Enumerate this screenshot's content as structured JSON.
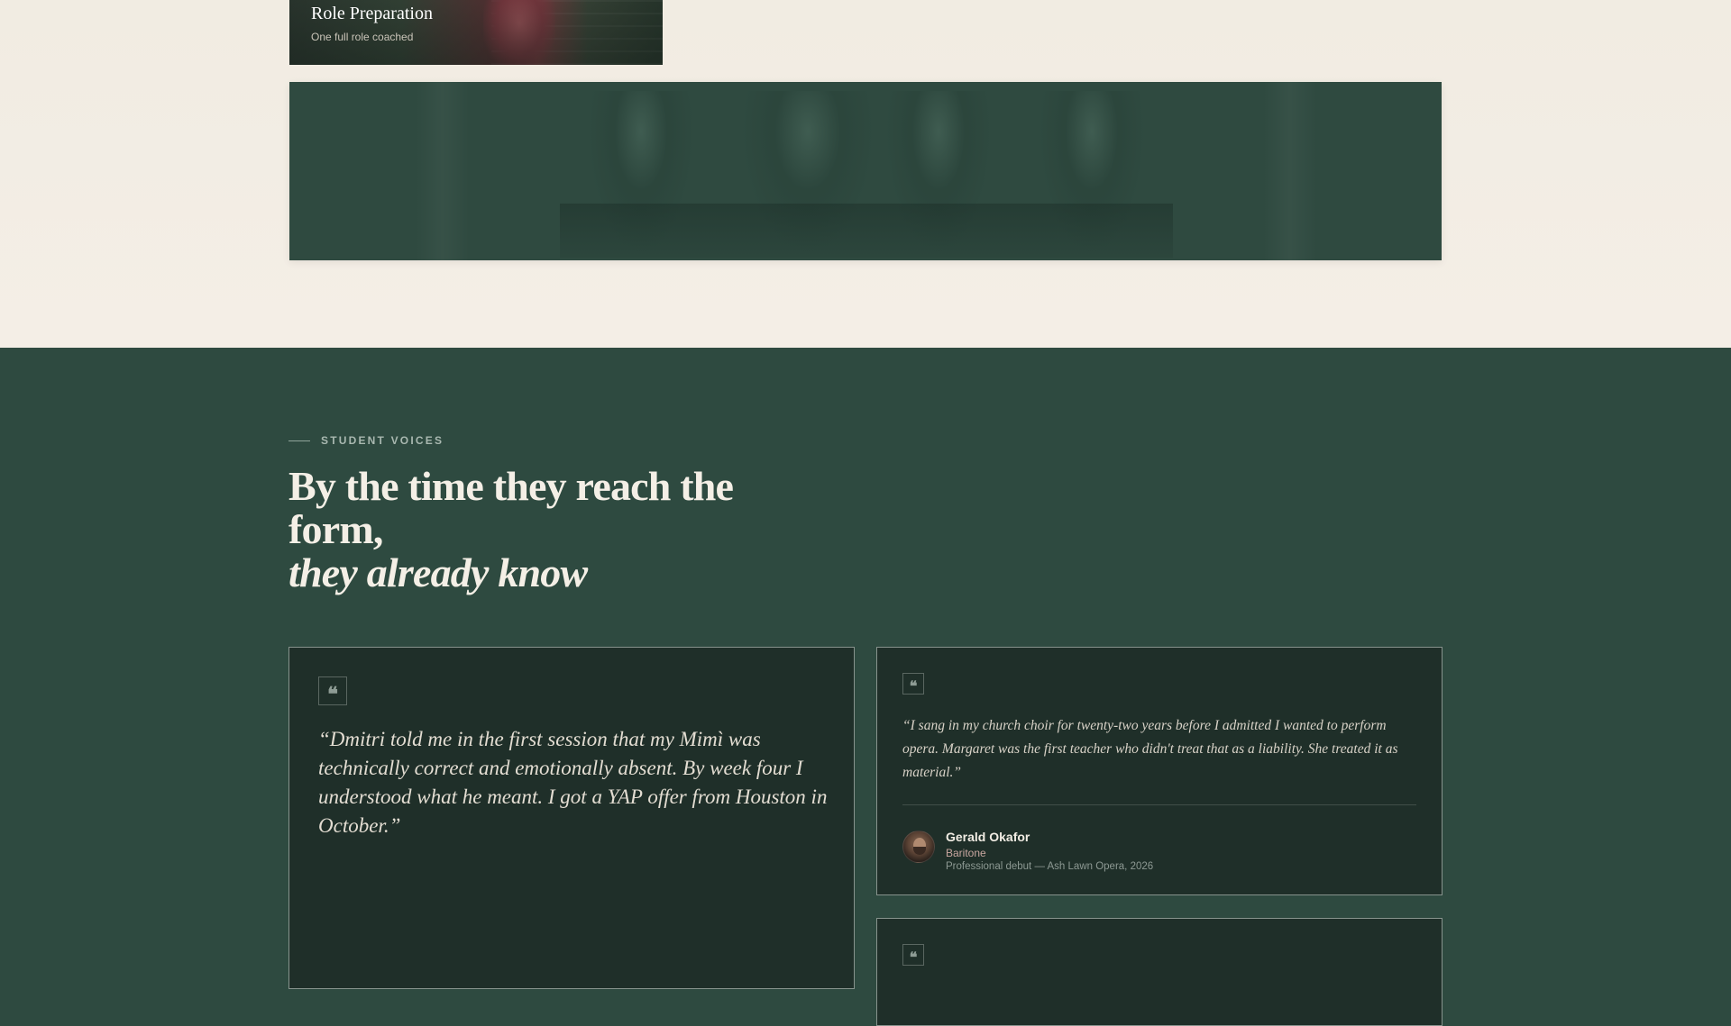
{
  "role_card": {
    "title": "Role Preparation",
    "subtitle": "One full role coached"
  },
  "section": {
    "eyebrow": "STUDENT VOICES",
    "heading_line1": "By the time they reach the form,",
    "heading_line2": "they already know"
  },
  "testimonials": [
    {
      "quote": "“Dmitri told me in the first session that my Mimì was technically correct and emotionally absent. By week four I understood what he meant. I got a YAP offer from Houston in October.”"
    },
    {
      "quote": "“I sang in my church choir for twenty-two years before I admitted I wanted to perform opera. Margaret was the first teacher who didn't treat that as a liability. She treated it as material.”",
      "name": "Gerald Okafor",
      "voice": "Baritone",
      "credit": "Professional debut — Ash Lawn Opera, 2026"
    }
  ],
  "icons": {
    "quote": "❝"
  },
  "colors": {
    "section_bg": "#2e4a40",
    "card_bg": "#1f2f29",
    "page_bg": "#f3eee5",
    "voice_accent": "#c9a7a0"
  }
}
